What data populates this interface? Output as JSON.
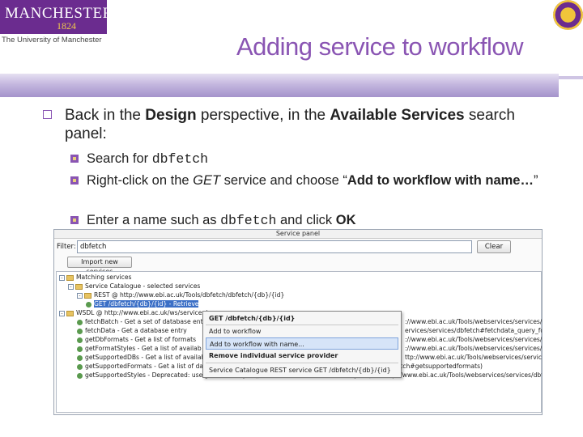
{
  "logo": {
    "name": "MANCHESTER",
    "year": "1824",
    "subtitle": "The University of Manchester"
  },
  "title": "Adding service to workflow",
  "bullets": {
    "b1_pre": "Back in the ",
    "b1_bold1": "Design",
    "b1_mid": " perspective, in the ",
    "b1_bold2": "Available Services",
    "b1_post": " search panel:",
    "sub1_pre": "Search for ",
    "sub1_code": "dbfetch",
    "sub2_pre": "Right-click on the ",
    "sub2_italic": "GET",
    "sub2_mid": " service and choose “",
    "sub2_bold": "Add to workflow with name…",
    "sub2_post": "”",
    "sub3_pre": "Enter a name such as ",
    "sub3_code": "dbfetch",
    "sub3_mid": " and click ",
    "sub3_bold": "OK"
  },
  "panel": {
    "title": "Service panel",
    "filter_label": "Filter:",
    "filter_value": "dbfetch",
    "clear_label": "Clear",
    "import_label": "Import new services",
    "tree": [
      "Matching services",
      "Service Catalogue - selected services",
      "REST @ http://www.ebi.ac.uk/Tools/dbfetch/dbfetch/{db}/{id}",
      "GET /dbfetch/{db}/{id} - Retrieve",
      "WSDL @ http://www.ebi.ac.uk/ws/services/",
      "fetchBatch - Get a set of database entr",
      "fetchData - Get a database entry",
      "getDbFormats - Get a list of formats",
      "getFormatStyles - Get a list of availab",
      "getSupportedDBs - Get a list of availab",
      "getSupportedFormats - Get a list of databases and formats (see http://www.ebi.ac.uk/ws/services/dbfetch#getsupportedformats)",
      "getSupportedStyles - Deprecated: use getFormatStyles(). Get a list of databases and styles (see http://www.ebi.ac.uk/Tools/webservices/services/dbfe"
    ],
    "tree_right": [
      "://www.ebi.ac.uk/Tools/webservices/services/dbfetch#fetchbatch_db_ids_format_style).",
      "ervices/services/dbfetch#fetchdata_query_format_style).",
      "://www.ebi.ac.uk/Tools/webservices/services/dbfetch#getdbformats_db).",
      "://www.ebi.ac.uk/Tools/webservices/services/dbfetch#getformatstyles_db_format).",
      "ttp://www.ebi.ac.uk/Tools/webservices/services/dbfetch#getsupporteddbs)."
    ],
    "context_menu": {
      "header": "GET /dbfetch/{db}/{id}",
      "items": [
        "Add to workflow",
        "Add to workflow with name...",
        "Remove individual service provider",
        "Service Catalogue REST service GET /dbfetch/{db}/{id}"
      ]
    }
  }
}
